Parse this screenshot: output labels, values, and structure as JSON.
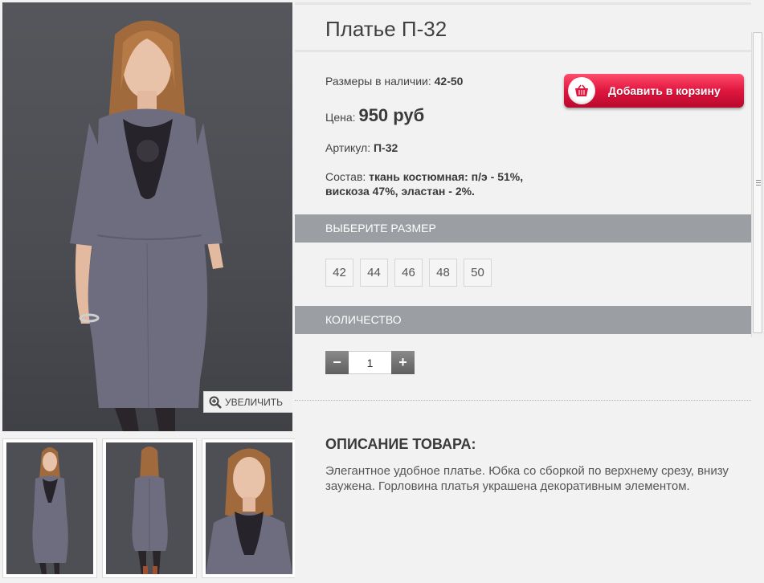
{
  "product": {
    "title": "Платье П-32",
    "sizes_label": "Размеры в наличии:",
    "sizes_value": "42-50",
    "price_label": "Цена:",
    "price_value": "950 руб",
    "article_label": "Артикул:",
    "article_value": "П-32",
    "composition_label": "Состав:",
    "composition_value": "ткань костюмная: п/э - 51%, вискоза 47%, эластан - 2%."
  },
  "cart_button": {
    "label": "Добавить в корзину",
    "icon": "basket-icon"
  },
  "size_section": {
    "header": "ВЫБЕРИТЕ РАЗМЕР",
    "options": [
      "42",
      "44",
      "46",
      "48",
      "50"
    ]
  },
  "quantity_section": {
    "header": "КОЛИЧЕСТВО",
    "minus": "−",
    "plus": "+",
    "value": "1"
  },
  "gallery": {
    "zoom_label": "УВЕЛИЧИТЬ",
    "zoom_icon": "magnifier-plus-icon",
    "thumbnails": [
      "front-view",
      "back-view",
      "closeup-view"
    ]
  },
  "description": {
    "title": "ОПИСАНИЕ ТОВАРА:",
    "text": "Элегантное удобное платье. Юбка со сборкой по верхнему срезу, внизу заужена. Горловина платья украшена декоративным элементом."
  },
  "colors": {
    "section_bar": "#9b9ea2",
    "cart_button": "#e0163e",
    "dress": "#6d6d7f",
    "background": "#f2f2f2"
  }
}
